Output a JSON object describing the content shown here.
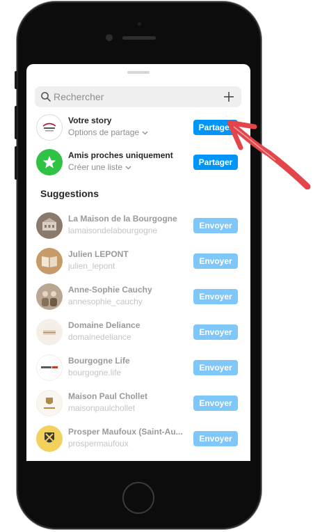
{
  "search": {
    "placeholder": "Rechercher"
  },
  "story": {
    "title": "Votre story",
    "subtitle": "Options de partage",
    "button": "Partager"
  },
  "close_friends": {
    "title": "Amis proches uniquement",
    "subtitle": "Créer une liste",
    "button": "Partager"
  },
  "suggestions": {
    "title": "Suggestions",
    "items": [
      {
        "name": "La Maison de la Bourgogne",
        "handle": "lamaisondelabourgogne",
        "button": "Envoyer"
      },
      {
        "name": "Julien LEPONT",
        "handle": "julien_lepont",
        "button": "Envoyer"
      },
      {
        "name": "Anne-Sophie Cauchy",
        "handle": "annesophie_cauchy",
        "button": "Envoyer"
      },
      {
        "name": "Domaine Deliance",
        "handle": "domainedeliance",
        "button": "Envoyer"
      },
      {
        "name": "Bourgogne Life",
        "handle": "bourgogne.life",
        "button": "Envoyer"
      },
      {
        "name": "Maison Paul Chollet",
        "handle": "maisonpaulchollet",
        "button": "Envoyer"
      },
      {
        "name": "Prosper Maufoux (Saint-Au...",
        "handle": "prospermaufoux",
        "button": "Envoyer"
      }
    ]
  },
  "colors": {
    "accent": "#0095f6",
    "accent_faded": "#7fc6f9",
    "close_friends_green": "#2fc244",
    "annotation_arrow": "#e2454a"
  }
}
